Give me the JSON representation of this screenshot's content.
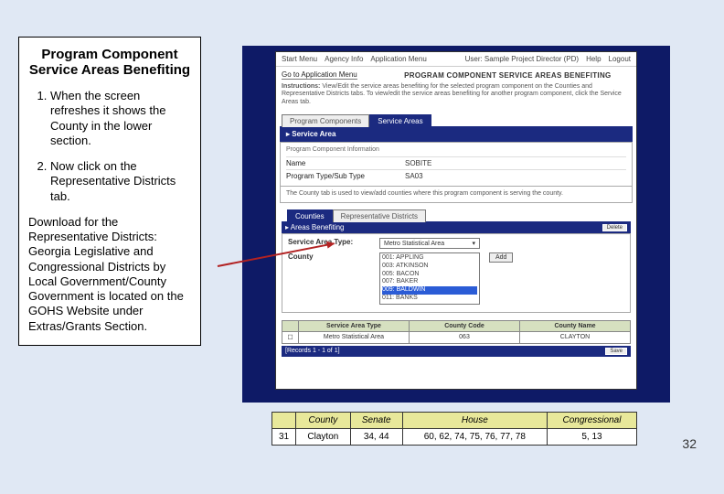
{
  "page_number": "32",
  "left_panel": {
    "title": "Program Component Service Areas Benefiting",
    "steps": [
      "When the screen refreshes it shows the County in the lower section.",
      "Now click on the Representative Districts tab."
    ],
    "download_note": "Download for the Representative Districts: Georgia Legislative and Congressional Districts by Local Government/County Government is located on the GOHS Website under Extras/Grants Section."
  },
  "app": {
    "top_nav_left": [
      "Start Menu",
      "Agency Info",
      "Application Menu"
    ],
    "top_nav_right": [
      "User: Sample Project Director (PD)",
      "Help",
      "Logout"
    ],
    "app_link": "Go to Application Menu",
    "app_title": "PROGRAM COMPONENT SERVICE AREAS BENEFITING",
    "instructions_label": "Instructions:",
    "instructions_text": "View/Edit the service areas benefiting for the selected program component on the Counties and Representative Districts tabs. To view/edit the service areas benefiting for another program component, click the Service Areas tab.",
    "outer_tabs": {
      "tab1": "Program Components",
      "tab2": "Service Areas"
    },
    "service_area_band": "Service Area",
    "pci_header": "Program Component Information",
    "pci_name_label": "Name",
    "pci_name_value": "SOBITE",
    "pci_type_label": "Program Type/Sub Type",
    "pci_type_value": "SA03",
    "county_note": "The County tab is used to view/add counties where this program component is serving the county.",
    "inner_tabs": {
      "tab1": "Counties",
      "tab2": "Representative Districts"
    },
    "areas_band": "Areas Benefiting",
    "delete_btn": "Delete",
    "service_area_type_label": "Service Area Type:",
    "service_area_type_value": "Metro Statistical Area",
    "county_label": "County",
    "add_btn": "Add",
    "county_options": [
      "001: APPLING",
      "003: ATKINSON",
      "005: BACON",
      "007: BAKER",
      "009: BALDWIN",
      "011: BANKS"
    ],
    "mini_table": {
      "h1": "Service Area Type",
      "h2": "County Code",
      "h3": "County Name",
      "r1": "Metro Statistical Area",
      "r2": "063",
      "r3": "CLAYTON",
      "chk": ""
    },
    "records_label": "[Records 1 - 1 of 1]",
    "save_btn": "Save"
  },
  "districts_table": {
    "headers": {
      "county": "County",
      "senate": "Senate",
      "house": "House",
      "congressional": "Congressional"
    },
    "row": {
      "idx": "31",
      "county": "Clayton",
      "senate": "34, 44",
      "house": "60, 62, 74, 75, 76, 77, 78",
      "congressional": "5, 13"
    }
  }
}
